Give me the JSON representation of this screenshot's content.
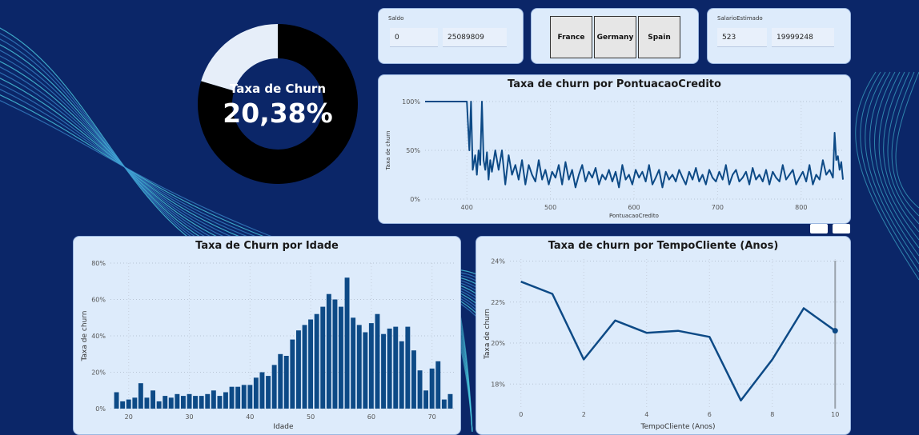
{
  "kpi": {
    "label": "Taxa de Churn",
    "value": "20,38%",
    "fraction": 0.2038,
    "colors": {
      "filled": "#000000",
      "remaining": "#e6eef9"
    }
  },
  "slicers": {
    "saldo": {
      "title": "Saldo",
      "min": "0",
      "max": "25089809"
    },
    "countries": [
      "France",
      "Germany",
      "Spain"
    ],
    "salario": {
      "title": "SalarioEstimado",
      "min": "523",
      "max": "19999248"
    }
  },
  "colors": {
    "background": "#0b2668",
    "card": "#ddebfb",
    "series": "#0d4a86"
  },
  "chart_data": [
    {
      "id": "pontuacao",
      "type": "line",
      "title": "Taxa de churn por PontuacaoCredito",
      "xlabel": "PontuacaoCredito",
      "ylabel": "Taxa de churn",
      "xlim": [
        350,
        850
      ],
      "ylim": [
        0,
        100
      ],
      "xticks": [
        400,
        500,
        600,
        700,
        800
      ],
      "yticks": [
        0,
        50,
        100
      ],
      "ytick_labels": [
        "0%",
        "50%",
        "100%"
      ],
      "x": [
        350,
        370,
        390,
        400,
        403,
        405,
        407,
        410,
        412,
        414,
        416,
        418,
        420,
        422,
        424,
        426,
        428,
        430,
        434,
        438,
        442,
        446,
        450,
        454,
        458,
        462,
        466,
        470,
        474,
        478,
        482,
        486,
        490,
        494,
        498,
        502,
        506,
        510,
        514,
        518,
        522,
        526,
        530,
        534,
        538,
        542,
        546,
        550,
        554,
        558,
        562,
        566,
        570,
        574,
        578,
        582,
        586,
        590,
        594,
        598,
        602,
        606,
        610,
        614,
        618,
        622,
        626,
        630,
        634,
        638,
        642,
        646,
        650,
        654,
        658,
        662,
        666,
        670,
        674,
        678,
        682,
        686,
        690,
        694,
        698,
        702,
        706,
        710,
        714,
        718,
        722,
        726,
        730,
        734,
        738,
        742,
        746,
        750,
        754,
        758,
        762,
        766,
        770,
        774,
        778,
        782,
        786,
        790,
        794,
        798,
        802,
        806,
        810,
        814,
        818,
        822,
        826,
        830,
        834,
        838,
        840,
        842,
        844,
        846,
        848,
        850
      ],
      "y": [
        100,
        100,
        100,
        100,
        50,
        100,
        30,
        45,
        25,
        50,
        35,
        100,
        40,
        30,
        48,
        20,
        40,
        28,
        50,
        30,
        50,
        15,
        45,
        25,
        35,
        20,
        40,
        15,
        35,
        25,
        18,
        40,
        20,
        30,
        15,
        28,
        22,
        35,
        15,
        38,
        20,
        30,
        12,
        25,
        35,
        18,
        28,
        22,
        32,
        15,
        25,
        20,
        30,
        18,
        28,
        12,
        35,
        20,
        25,
        15,
        30,
        22,
        28,
        18,
        35,
        15,
        22,
        30,
        12,
        28,
        20,
        25,
        18,
        30,
        22,
        15,
        28,
        20,
        32,
        18,
        25,
        15,
        30,
        22,
        18,
        28,
        20,
        35,
        15,
        25,
        30,
        18,
        22,
        28,
        15,
        32,
        20,
        25,
        18,
        30,
        15,
        28,
        22,
        18,
        35,
        20,
        25,
        30,
        15,
        22,
        28,
        18,
        35,
        15,
        25,
        20,
        40,
        25,
        30,
        22,
        68,
        40,
        44,
        30,
        38,
        20
      ]
    },
    {
      "id": "idade",
      "type": "bar",
      "title": "Taxa de Churn por Idade",
      "xlabel": "Idade",
      "ylabel": "Taxa de churn",
      "xlim": [
        17,
        74
      ],
      "ylim": [
        0,
        80
      ],
      "xticks": [
        20,
        30,
        40,
        50,
        60,
        70
      ],
      "yticks": [
        0,
        20,
        40,
        60,
        80
      ],
      "ytick_labels": [
        "0%",
        "20%",
        "40%",
        "60%",
        "80%"
      ],
      "x": [
        18,
        19,
        20,
        21,
        22,
        23,
        24,
        25,
        26,
        27,
        28,
        29,
        30,
        31,
        32,
        33,
        34,
        35,
        36,
        37,
        38,
        39,
        40,
        41,
        42,
        43,
        44,
        45,
        46,
        47,
        48,
        49,
        50,
        51,
        52,
        53,
        54,
        55,
        56,
        57,
        58,
        59,
        60,
        61,
        62,
        63,
        64,
        65,
        66,
        67,
        68,
        69,
        70,
        71,
        72,
        73
      ],
      "values": [
        9,
        4,
        5,
        6,
        14,
        6,
        10,
        4,
        7,
        6,
        8,
        7,
        8,
        7,
        7,
        8,
        10,
        7,
        9,
        12,
        12,
        13,
        13,
        17,
        20,
        18,
        24,
        30,
        29,
        38,
        43,
        46,
        49,
        52,
        56,
        63,
        60,
        56,
        72,
        50,
        46,
        42,
        47,
        52,
        41,
        44,
        45,
        37,
        45,
        32,
        21,
        10,
        22,
        26,
        5,
        8,
        6
      ]
    },
    {
      "id": "tempo",
      "type": "line",
      "title": "Taxa de churn por TempoCliente (Anos)",
      "xlabel": "TempoCliente (Anos)",
      "ylabel": "Taxa de churn",
      "xlim": [
        -0.35,
        10.35
      ],
      "ylim": [
        16.8,
        24.1
      ],
      "xticks": [
        0,
        2,
        4,
        6,
        8,
        10
      ],
      "yticks": [
        18,
        20,
        22,
        24
      ],
      "ytick_labels": [
        "18%",
        "20%",
        "22%",
        "24%"
      ],
      "x": [
        0,
        1,
        2,
        3,
        4,
        5,
        6,
        7,
        8,
        9,
        10
      ],
      "y": [
        23.0,
        22.4,
        19.2,
        21.1,
        20.5,
        20.6,
        20.3,
        17.2,
        19.2,
        21.7,
        20.6
      ]
    }
  ]
}
